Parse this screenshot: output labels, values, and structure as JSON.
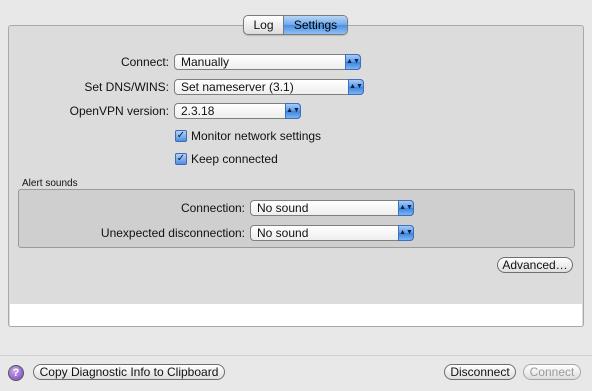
{
  "tabs": [
    {
      "label": "Log",
      "selected": false
    },
    {
      "label": "Settings",
      "selected": true
    }
  ],
  "settings": {
    "connect_label": "Connect:",
    "connect_value": "Manually",
    "dns_label": "Set DNS/WINS:",
    "dns_value": "Set nameserver (3.1)",
    "openvpn_label": "OpenVPN version:",
    "openvpn_value": "2.3.18",
    "monitor_label": "Monitor network settings",
    "monitor_checked": true,
    "keep_label": "Keep connected",
    "keep_checked": true
  },
  "alert_sounds": {
    "title": "Alert sounds",
    "connection_label": "Connection:",
    "connection_value": "No sound",
    "disconnection_label": "Unexpected disconnection:",
    "disconnection_value": "No sound"
  },
  "buttons": {
    "advanced": "Advanced…",
    "copy_diag": "Copy Diagnostic Info to Clipboard",
    "disconnect": "Disconnect",
    "connect": "Connect",
    "help": "?"
  },
  "colors": {
    "accent": "#4a8fe3",
    "help": "#7a3fbf"
  }
}
